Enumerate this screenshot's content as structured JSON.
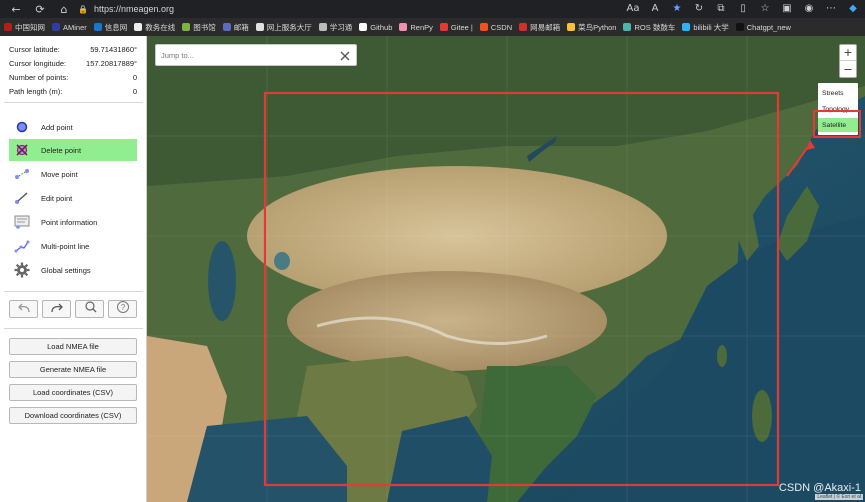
{
  "browser": {
    "url": "https://nmeagen.org",
    "bookmarks": [
      {
        "label": "中国知网",
        "color": "#b71c1c"
      },
      {
        "label": "AMiner",
        "color": "#303f9f"
      },
      {
        "label": "信息网",
        "color": "#1976d2"
      },
      {
        "label": "教务在线",
        "color": "#eeeeee"
      },
      {
        "label": "图书馆",
        "color": "#7cb342"
      },
      {
        "label": "邮箱",
        "color": "#5c6bc0"
      },
      {
        "label": "网上服务大厅",
        "color": "#e0e0e0"
      },
      {
        "label": "学习通",
        "color": "#bdbdbd"
      },
      {
        "label": "Github",
        "color": "#fafafa"
      },
      {
        "label": "RenPy",
        "color": "#f48fb1"
      },
      {
        "label": "Gitee |",
        "color": "#e53935"
      },
      {
        "label": "CSDN",
        "color": "#f4511e"
      },
      {
        "label": "网易邮箱",
        "color": "#d32f2f"
      },
      {
        "label": "菜鸟Python",
        "color": "#fbc02d"
      },
      {
        "label": "ROS 鼓鼓车",
        "color": "#4db6ac"
      },
      {
        "label": "bilibili 大学",
        "color": "#29b6f6"
      },
      {
        "label": "Chatgpt_new",
        "color": "#111111"
      }
    ]
  },
  "sidebar": {
    "info": [
      {
        "label": "Cursor latitude:",
        "value": "59.71431860°"
      },
      {
        "label": "Cursor longitude:",
        "value": "157.20817889°"
      },
      {
        "label": "Number of points:",
        "value": "0"
      },
      {
        "label": "Path length (m):",
        "value": "0"
      }
    ],
    "tools": [
      {
        "label": "Add point",
        "icon": "add-point-icon",
        "active": false
      },
      {
        "label": "Delete point",
        "icon": "delete-point-icon",
        "active": true
      },
      {
        "label": "Move point",
        "icon": "move-point-icon",
        "active": false
      },
      {
        "label": "Edit point",
        "icon": "edit-point-icon",
        "active": false
      },
      {
        "label": "Point information",
        "icon": "point-information-icon",
        "active": false
      },
      {
        "label": "Multi-point line",
        "icon": "multi-point-line-icon",
        "active": false
      },
      {
        "label": "Global settings",
        "icon": "gear-icon",
        "active": false
      }
    ],
    "files": {
      "load_nmea": "Load NMEA file",
      "generate_nmea": "Generate NMEA file",
      "load_csv": "Load coordinates (CSV)",
      "download_csv": "Download coordinates (CSV)"
    }
  },
  "map": {
    "search_placeholder": "Jump to...",
    "zoom_in": "+",
    "zoom_out": "−",
    "layers": [
      "Streets",
      "Topology",
      "Satellite"
    ],
    "selected_layer": "Satellite",
    "attribution": "Leaflet | © Esri et al",
    "watermark": "CSDN @Akaxi-1"
  },
  "colors": {
    "active_tool": "#90ee90",
    "annotation_red": "#e53935",
    "ocean": "#1f4f66"
  }
}
